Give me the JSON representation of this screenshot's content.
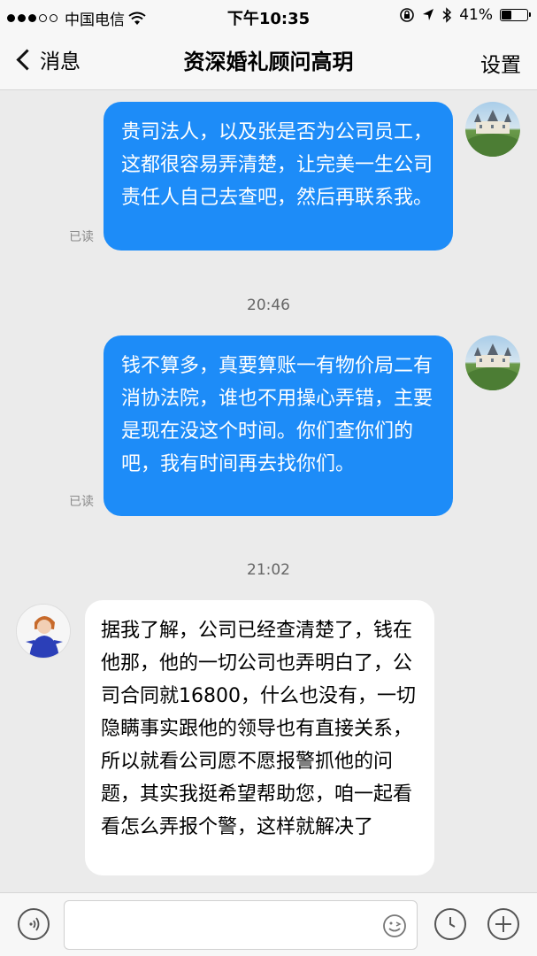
{
  "status_bar": {
    "carrier": "中国电信",
    "time": "下午10:35",
    "battery_text": "41%",
    "battery_level": 0.41,
    "icons": [
      "signal-dots-icon",
      "wifi-icon",
      "orientation-lock-icon",
      "location-icon",
      "bluetooth-icon",
      "battery-icon"
    ]
  },
  "nav": {
    "back_label": "消息",
    "title": "资深婚礼顾问高玥",
    "settings_label": "设置"
  },
  "messages": [
    {
      "direction": "out",
      "text": "贵司法人，以及张是否为公司员工，这都很容易弄清楚，让完美一生公司责任人自己去查吧，然后再联系我。",
      "status": "已读",
      "avatar": "castle-avatar"
    },
    {
      "timestamp": "20:46"
    },
    {
      "direction": "out",
      "text": "钱不算多，真要算账一有物价局二有消协法院，谁也不用操心弄错，主要是现在没这个时间。你们查你们的吧，我有时间再去找你们。",
      "status": "已读",
      "avatar": "castle-avatar"
    },
    {
      "timestamp": "21:02"
    },
    {
      "direction": "in",
      "text": "据我了解，公司已经查清楚了，钱在他那，他的一切公司也弄明白了，公司合同就16800，什么也没有，一切隐瞒事实跟他的领导也有直接关系，所以就看公司愿不愿报警抓他的问题，其实我挺希望帮助您，咱一起看看怎么弄报个警，这样就解决了",
      "avatar": "person-avatar"
    }
  ],
  "input_bar": {
    "icons": [
      "voice-icon",
      "emoji-icon",
      "clock-icon",
      "plus-icon"
    ],
    "placeholder": ""
  },
  "colors": {
    "outgoing_bubble": "#1d8cf8",
    "incoming_bubble": "#ffffff",
    "chat_background": "#ebebeb"
  }
}
